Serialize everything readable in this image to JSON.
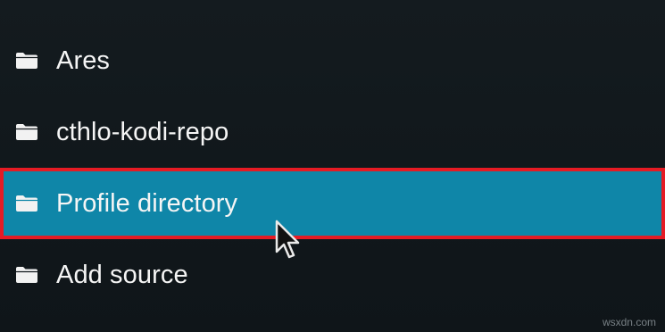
{
  "sources": [
    {
      "label": "Ares",
      "icon": "folder-icon",
      "selected": false
    },
    {
      "label": "cthlo-kodi-repo",
      "icon": "folder-icon",
      "selected": false
    },
    {
      "label": "Profile directory",
      "icon": "folder-icon",
      "selected": true
    },
    {
      "label": "Add source",
      "icon": "folder-icon",
      "selected": false
    }
  ],
  "colors": {
    "background": "#12191d",
    "selected_background": "#0f86a8",
    "highlight_border": "#e51b24",
    "text": "#f5f5f5"
  },
  "watermark": "wsxdn.com"
}
